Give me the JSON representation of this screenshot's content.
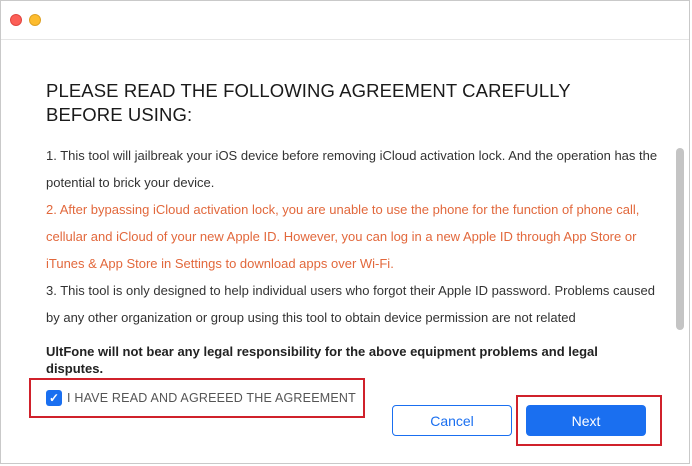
{
  "window": {
    "title_buttons": [
      "close",
      "minimize"
    ]
  },
  "heading": {
    "line1": "PLEASE READ THE FOLLOWING AGREEMENT CAREFULLY",
    "line2": "BEFORE USING:"
  },
  "agreement": {
    "item1": "1. This tool will jailbreak your iOS device before removing iCloud activation lock. And the operation has the potential to brick your device.",
    "item2": "2. After bypassing iCloud activation lock, you are unable to use the phone for the function of phone call, cellular and iCloud of your new Apple ID. However, you can log in a new Apple ID through App Store or iTunes & App Store in Settings to download apps over Wi-Fi.",
    "item3": "3. This tool is only designed to help individual users who forgot their Apple ID password. Problems caused by any other organization or group using this tool to obtain device permission are not related"
  },
  "disclaimer": "UltFone will not bear any legal responsibility for the above equipment problems and legal disputes.",
  "agree_checkbox": {
    "checked": true,
    "label": "I HAVE READ AND AGREEED THE AGREEMENT"
  },
  "buttons": {
    "cancel": "Cancel",
    "next": "Next"
  },
  "colors": {
    "accent": "#1a6ff0",
    "warning_text": "#e2683c",
    "highlight_box": "#d0212b"
  }
}
